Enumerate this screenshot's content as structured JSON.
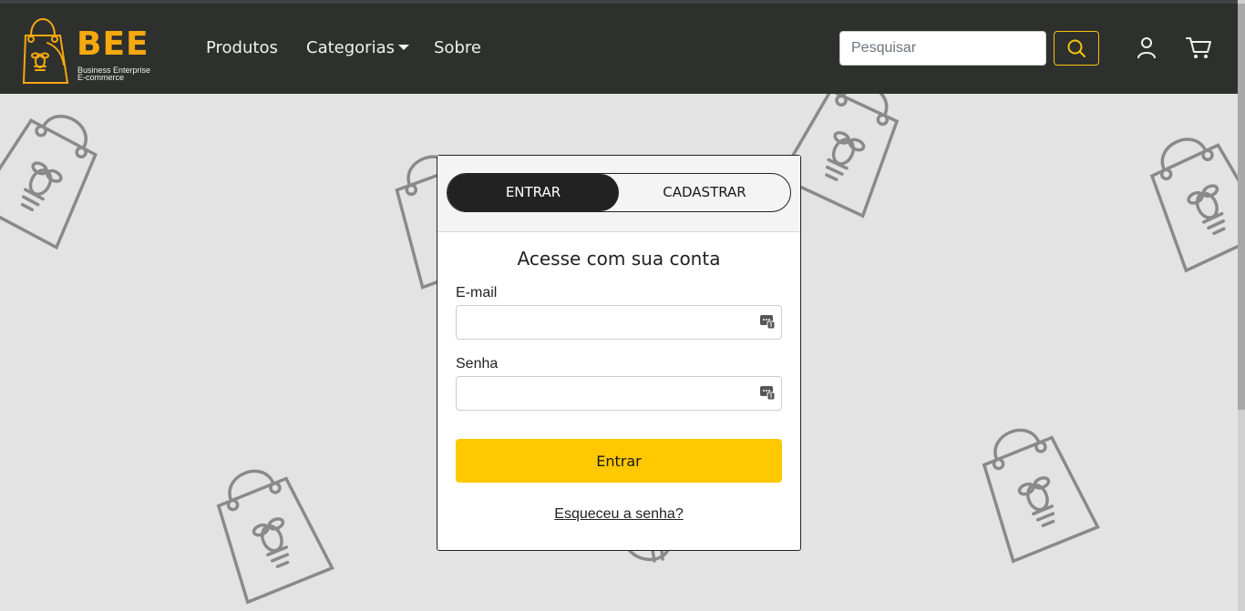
{
  "brand": {
    "name": "BEE",
    "tagline_line1": "Business Enterprise",
    "tagline_line2": "E-commerce",
    "color": "#f5a90f"
  },
  "nav": {
    "links": [
      {
        "label": "Produtos"
      },
      {
        "label": "Categorias",
        "has_dropdown": true
      },
      {
        "label": "Sobre"
      }
    ]
  },
  "search": {
    "placeholder": "Pesquisar",
    "value": "",
    "button_icon": "search-icon"
  },
  "header_icons": [
    "user-icon",
    "cart-icon"
  ],
  "login_card": {
    "tabs": [
      {
        "label": "ENTRAR",
        "active": true
      },
      {
        "label": "CADASTRAR",
        "active": false
      }
    ],
    "title": "Acesse com sua conta",
    "fields": [
      {
        "label": "E-mail",
        "value": "",
        "icon": "password-manager-icon"
      },
      {
        "label": "Senha",
        "value": "",
        "icon": "password-manager-icon"
      }
    ],
    "submit_label": "Entrar",
    "forgot_link": "Esqueceu a senha?"
  },
  "colors": {
    "navbar": "#2e302e",
    "accent": "#ffc800",
    "background": "#e3e3e3",
    "decoration": "#8a8a8a"
  }
}
